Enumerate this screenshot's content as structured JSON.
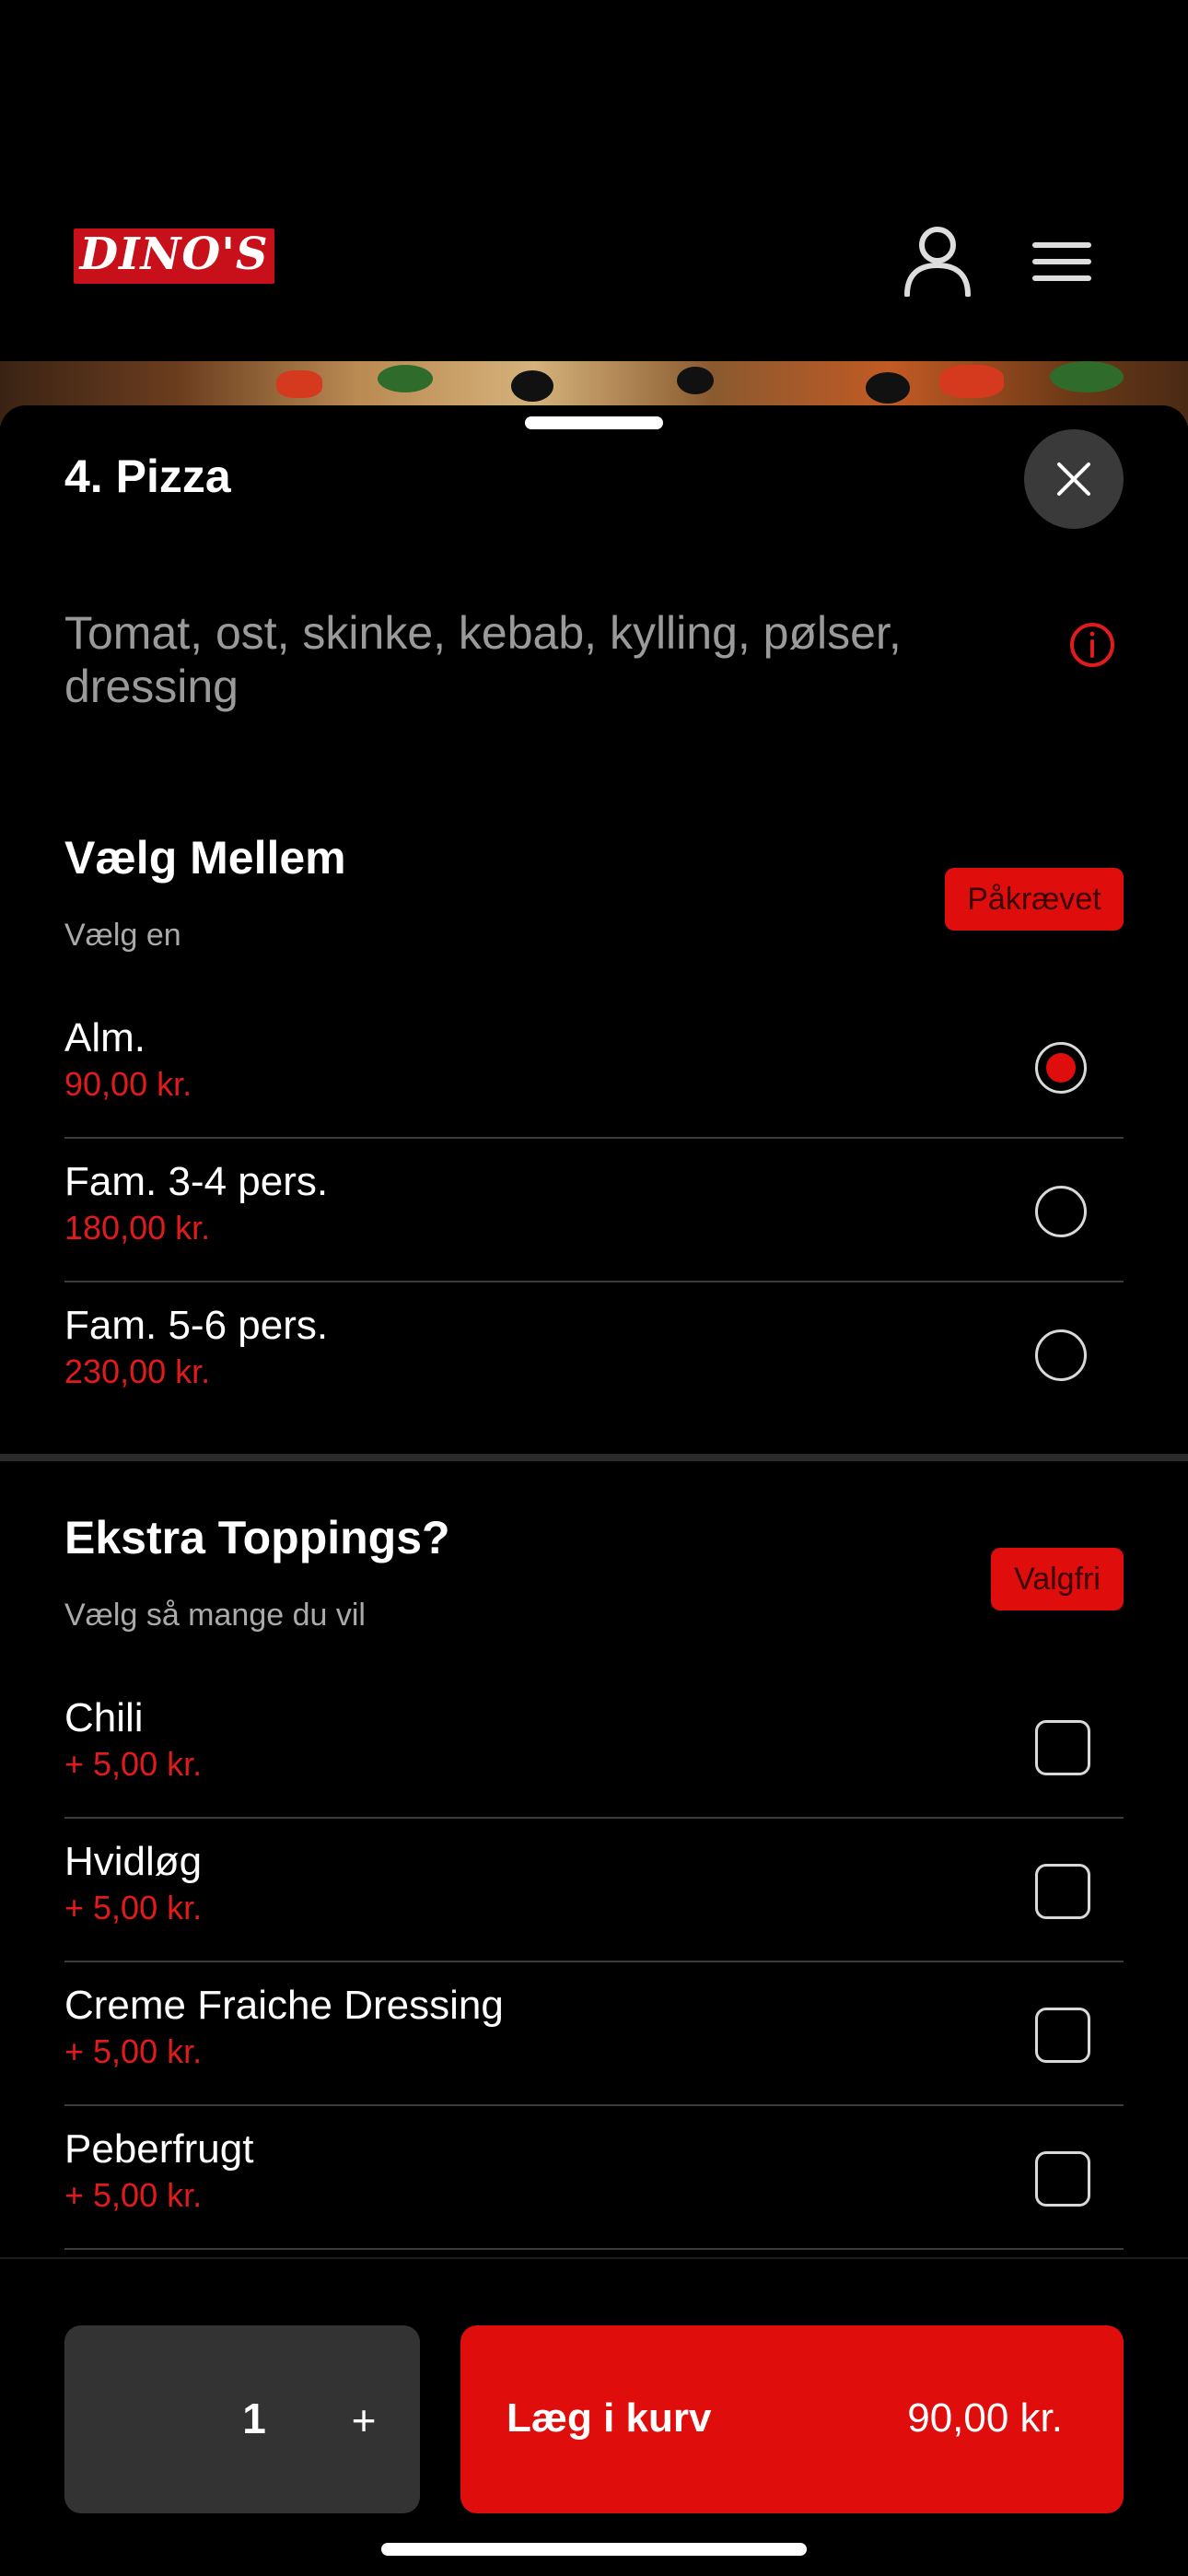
{
  "header": {
    "logo_text": "DINO'S",
    "brand_color": "#c8101a",
    "user_icon": "user-icon",
    "menu_icon": "hamburger-menu-icon"
  },
  "product": {
    "title": "4. Pizza",
    "description": "Tomat, ost, skinke, kebab, kylling, pølser, dressing"
  },
  "size_section": {
    "title": "Vælg Mellem",
    "subtitle": "Vælg en",
    "badge": "Påkrævet",
    "options": [
      {
        "name": "Alm.",
        "price": "90,00 kr.",
        "selected": true
      },
      {
        "name": "Fam. 3-4 pers.",
        "price": "180,00 kr.",
        "selected": false
      },
      {
        "name": "Fam. 5-6 pers.",
        "price": "230,00 kr.",
        "selected": false
      }
    ]
  },
  "toppings_section": {
    "title": "Ekstra Toppings?",
    "subtitle": "Vælg så mange du vil",
    "badge": "Valgfri",
    "options": [
      {
        "name": "Chili",
        "price": "+ 5,00 kr.",
        "checked": false
      },
      {
        "name": "Hvidløg",
        "price": "+ 5,00 kr.",
        "checked": false
      },
      {
        "name": "Creme Fraiche Dressing",
        "price": "+ 5,00 kr.",
        "checked": false
      },
      {
        "name": "Peberfrugt",
        "price": "+ 5,00 kr.",
        "checked": false
      }
    ]
  },
  "cart_bar": {
    "quantity": "1",
    "plus_label": "+",
    "add_label": "Læg i kurv",
    "total": "90,00 kr."
  },
  "colors": {
    "accent": "#e00d0d",
    "background": "#000000",
    "muted_text": "#9a9a9a"
  }
}
